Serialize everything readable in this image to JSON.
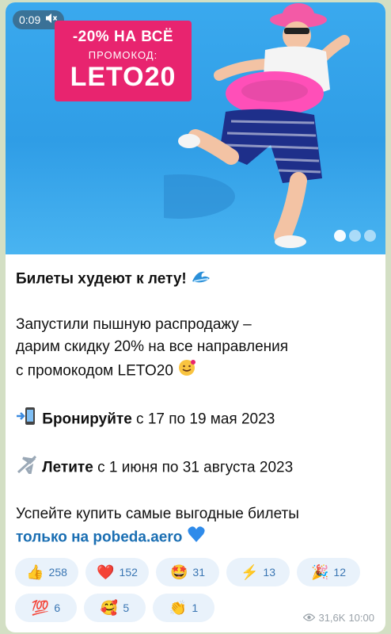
{
  "media": {
    "duration": "0:09",
    "promo_line1": "-20% НА ВСЁ",
    "promo_line2": "ПРОМОКОД:",
    "promo_code": "LETO20",
    "slide_dots": 3,
    "active_slide": 1
  },
  "post": {
    "headline": "Билеты худеют к лету!",
    "para1_line1": "Запустили пышную распродажу –",
    "para1_line2": "дарим скидку 20% на все направления",
    "para1_line3": "с промокодом LETO20",
    "book_bold": "Бронируйте",
    "book_rest": " с 17 по 19 мая 2023",
    "fly_bold": "Летите",
    "fly_rest": " с 1 июня по 31 августа 2023",
    "cta_line1": "Успейте купить самые выгодные билеты",
    "cta_link": "только на pobeda.aero"
  },
  "reactions": [
    {
      "icon": "thumbs-up-icon",
      "glyph": "👍",
      "count": "258"
    },
    {
      "icon": "heart-icon",
      "glyph": "❤️",
      "count": "152"
    },
    {
      "icon": "star-struck-icon",
      "glyph": "🤩",
      "count": "31"
    },
    {
      "icon": "lightning-icon",
      "glyph": "⚡",
      "count": "13"
    },
    {
      "icon": "party-popper-icon",
      "glyph": "🎉",
      "count": "12"
    },
    {
      "icon": "hundred-icon",
      "glyph": "💯",
      "count": "6"
    },
    {
      "icon": "smiling-hearts-icon",
      "glyph": "🥰",
      "count": "5"
    },
    {
      "icon": "clapping-hands-icon",
      "glyph": "👏",
      "count": "1"
    }
  ],
  "meta": {
    "views": "31,6K",
    "time": "10:00"
  },
  "colors": {
    "promo_bg": "#e8246f",
    "link": "#1b6fb3",
    "reaction_bg": "#e9f2fb",
    "reaction_text": "#3a76b3"
  }
}
